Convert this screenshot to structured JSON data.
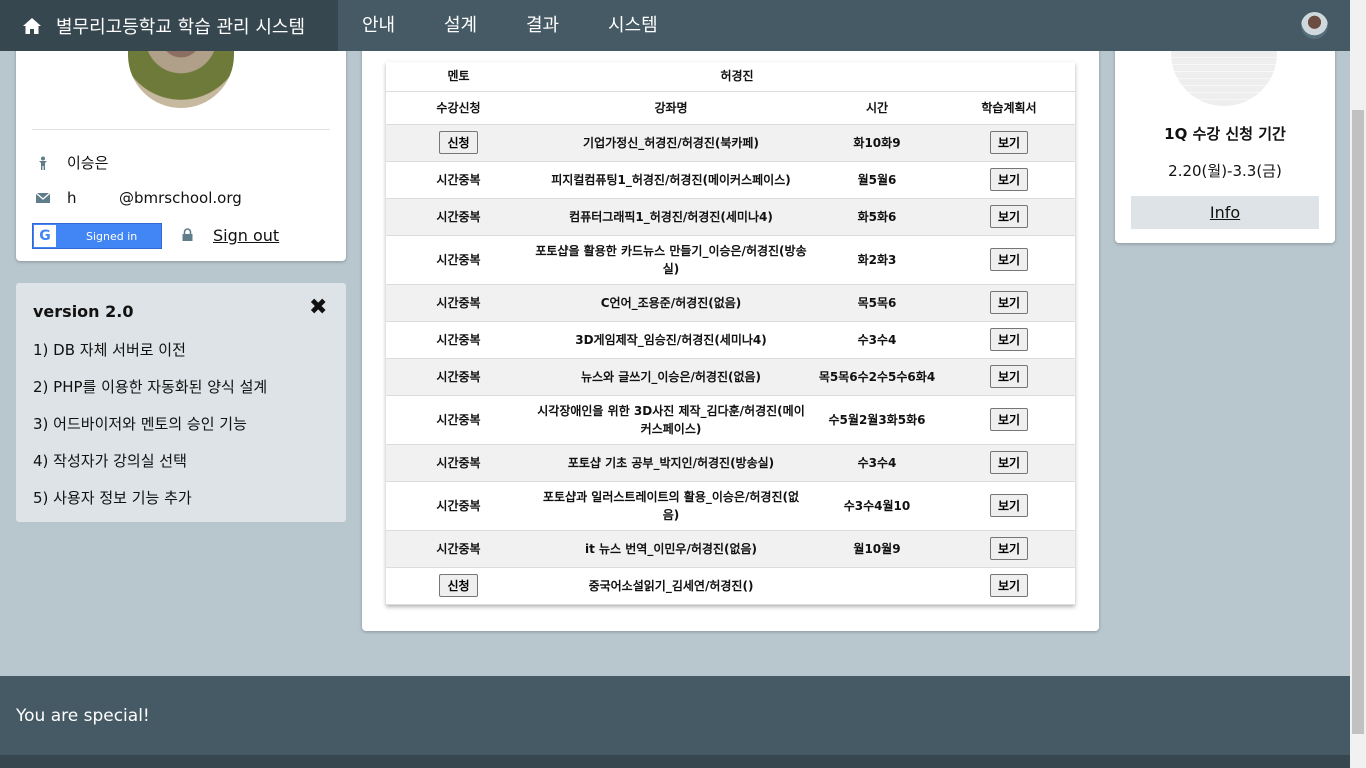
{
  "nav": {
    "brand": "별무리고등학교 학습 관리 시스템",
    "items": [
      "안내",
      "설계",
      "결과",
      "시스템"
    ]
  },
  "profile": {
    "name": "이승은",
    "email_local": "h",
    "email_domain": "@bmrschool.org",
    "google_label": "Signed in",
    "signout": "Sign out"
  },
  "version": {
    "title": "version 2.0",
    "items": [
      "1) DB 자체 서버로 이전",
      "2) PHP를 이용한 자동화된 양식 설계",
      "3) 어드바이저와 멘토의 승인 기능",
      "4) 작성자가 강의실 선택",
      "5) 사용자 정보 기능 추가"
    ]
  },
  "table": {
    "mentor_label": "멘토",
    "mentor_name": "허경진",
    "headers": [
      "수강신청",
      "강좌명",
      "시간",
      "학습계획서"
    ],
    "rows": [
      {
        "status": "신청",
        "status_button": true,
        "course": "기업가정신_허경진/허경진(북카페)",
        "time": "화10화9",
        "plan": "보기"
      },
      {
        "status": "시간중복",
        "status_button": false,
        "course": "피지컬컴퓨팅1_허경진/허경진(메이커스페이스)",
        "time": "월5월6",
        "plan": "보기"
      },
      {
        "status": "시간중복",
        "status_button": false,
        "course": "컴퓨터그래픽1_허경진/허경진(세미나4)",
        "time": "화5화6",
        "plan": "보기"
      },
      {
        "status": "시간중복",
        "status_button": false,
        "course": "포토샵을 활용한 카드뉴스 만들기_이승은/허경진(방송실)",
        "time": "화2화3",
        "plan": "보기"
      },
      {
        "status": "시간중복",
        "status_button": false,
        "course": "C언어_조용준/허경진(없음)",
        "time": "목5목6",
        "plan": "보기"
      },
      {
        "status": "시간중복",
        "status_button": false,
        "course": "3D게임제작_임승진/허경진(세미나4)",
        "time": "수3수4",
        "plan": "보기"
      },
      {
        "status": "시간중복",
        "status_button": false,
        "course": "뉴스와 글쓰기_이승은/허경진(없음)",
        "time": "목5목6수2수5수6화4",
        "plan": "보기"
      },
      {
        "status": "시간중복",
        "status_button": false,
        "course": "시각장애인을 위한 3D사진 제작_김다훈/허경진(메이커스페이스)",
        "time": "수5월2월3화5화6",
        "plan": "보기"
      },
      {
        "status": "시간중복",
        "status_button": false,
        "course": "포토샵 기초 공부_박지인/허경진(방송실)",
        "time": "수3수4",
        "plan": "보기"
      },
      {
        "status": "시간중복",
        "status_button": false,
        "course": "포토샵과 일러스트레이트의 활용_이승은/허경진(없음)",
        "time": "수3수4월10",
        "plan": "보기"
      },
      {
        "status": "시간중복",
        "status_button": false,
        "course": "it 뉴스 번역_이민우/허경진(없음)",
        "time": "월10월9",
        "plan": "보기"
      },
      {
        "status": "신청",
        "status_button": true,
        "course": "중국어소설읽기_김세연/허경진()",
        "time": "",
        "plan": "보기"
      }
    ]
  },
  "period": {
    "title": "1Q 수강 신청 기간",
    "dates": "2.20(월)-3.3(금)",
    "info": "Info"
  },
  "footer": {
    "text": "You are special!"
  }
}
